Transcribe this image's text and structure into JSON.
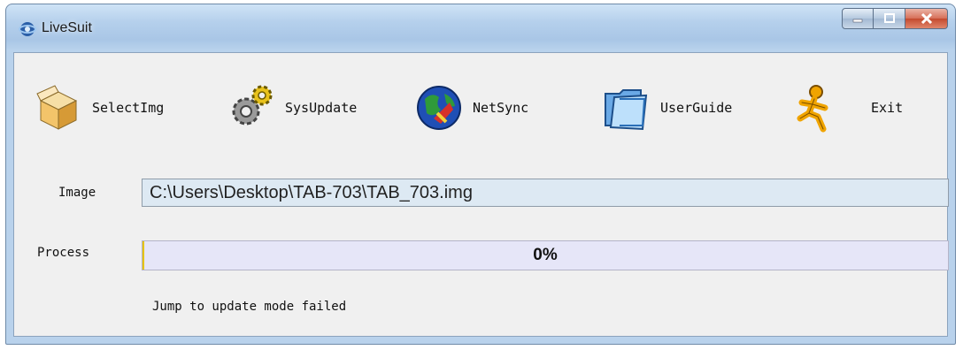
{
  "window": {
    "title": "LiveSuit",
    "icon": "livesuit-app-icon",
    "controls": {
      "minimize": "minimize-icon",
      "maximize": "maximize-icon",
      "close": "close-icon"
    }
  },
  "toolbar": {
    "items": [
      {
        "label": "SelectImg",
        "icon": "open-image-box-icon"
      },
      {
        "label": "SysUpdate",
        "icon": "gears-icon"
      },
      {
        "label": "NetSync",
        "icon": "globe-sync-icon"
      },
      {
        "label": "UserGuide",
        "icon": "folder-icon"
      },
      {
        "label": "Exit",
        "icon": "running-person-icon"
      }
    ]
  },
  "image": {
    "label": "Image",
    "value": "C:\\Users\\Desktop\\TAB-703\\TAB_703.img"
  },
  "process": {
    "label": "Process",
    "percent_text": "0%",
    "fraction": 0.0
  },
  "status": {
    "message": "Jump to update mode failed"
  },
  "colors": {
    "progress_fill": "#e6c300",
    "progress_track": "#e6e6f8",
    "field_bg": "#dde9f3",
    "titlebar": "#b5d0ec"
  }
}
